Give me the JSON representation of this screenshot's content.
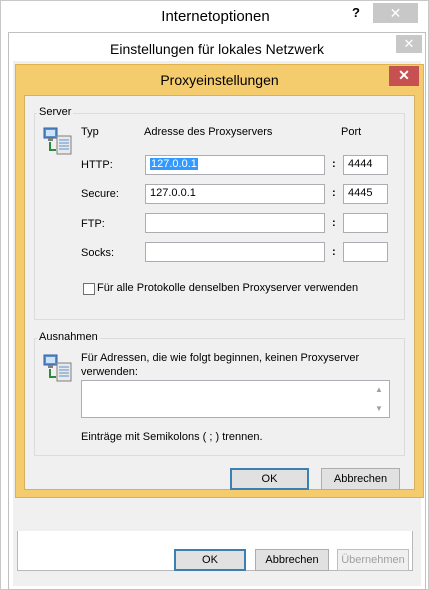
{
  "internet_options": {
    "title": "Internetoptionen",
    "help_icon": "?",
    "close_icon": "✕",
    "buttons": {
      "ok": "OK",
      "cancel": "Abbrechen",
      "apply": "Übernehmen"
    }
  },
  "lan_settings": {
    "title": "Einstellungen für lokales Netzwerk",
    "close_icon": "✕"
  },
  "proxy_settings": {
    "title": "Proxyeinstellungen",
    "close_icon": "✕",
    "server_group": {
      "legend": "Server",
      "col_type": "Typ",
      "col_address": "Adresse des Proxyservers",
      "col_port": "Port",
      "rows": [
        {
          "type": "HTTP:",
          "address": "127.0.0.1",
          "port": "4444"
        },
        {
          "type": "Secure:",
          "address": "127.0.0.1",
          "port": "4445"
        },
        {
          "type": "FTP:",
          "address": "",
          "port": ""
        },
        {
          "type": "Socks:",
          "address": "",
          "port": ""
        }
      ],
      "colon": ":",
      "same_proxy_label": "Für alle Protokolle denselben Proxyserver verwenden"
    },
    "exceptions_group": {
      "legend": "Ausnahmen",
      "description": "Für Adressen, die wie folgt beginnen, keinen Proxyserver verwenden:",
      "textarea_value": "",
      "hint": "Einträge mit Semikolons ( ; ) trennen."
    },
    "buttons": {
      "ok": "OK",
      "cancel": "Abbrechen"
    }
  },
  "colors": {
    "proxy_frame": "#f4cc6e",
    "close_red": "#c75050",
    "selection": "#3399ff"
  }
}
